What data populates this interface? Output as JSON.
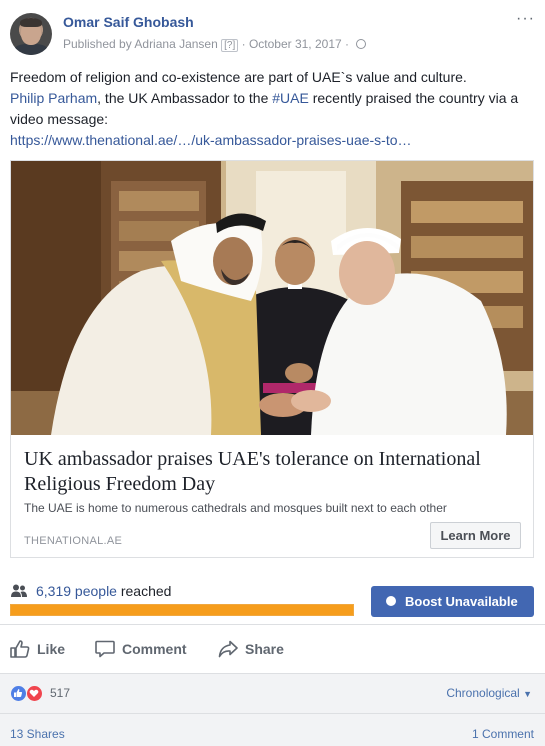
{
  "post": {
    "author": "Omar Saif Ghobash",
    "published_by": "Published by Adriana Jansen",
    "help_mark": "[?]",
    "date_sep": "·",
    "date": "October 31, 2017",
    "text_line1": "Freedom of religion and co-existence are part of UAE`s value and culture.",
    "mention": "Philip Parham",
    "text_mid": ", the UK Ambassador to the ",
    "hashtag": "#UAE",
    "text_end": " recently praised the country via a video message:",
    "url": "https://www.thenational.ae/…/uk-ambassador-praises-uae-s-to…"
  },
  "card": {
    "title": "UK ambassador praises UAE's tolerance on International Religious Freedom Day",
    "description": "The UAE is home to numerous cathedrals and mosques built next to each other",
    "domain": "THENATIONAL.AE",
    "cta": "Learn More"
  },
  "reach": {
    "count": "6,319 people",
    "suffix": " reached",
    "fill_fraction": 1.0,
    "boost_label": "Boost Unavailable"
  },
  "actions": {
    "like": "Like",
    "comment": "Comment",
    "share": "Share"
  },
  "engagement": {
    "reaction_count": "517",
    "sort_label": "Chronological",
    "shares": "13 Shares",
    "comments": "1 Comment"
  },
  "colors": {
    "link": "#365899",
    "boost": "#4267b2",
    "reach_fill": "#f69d1c",
    "like_reaction": "#4f7fe6",
    "love_reaction": "#f0454e"
  }
}
